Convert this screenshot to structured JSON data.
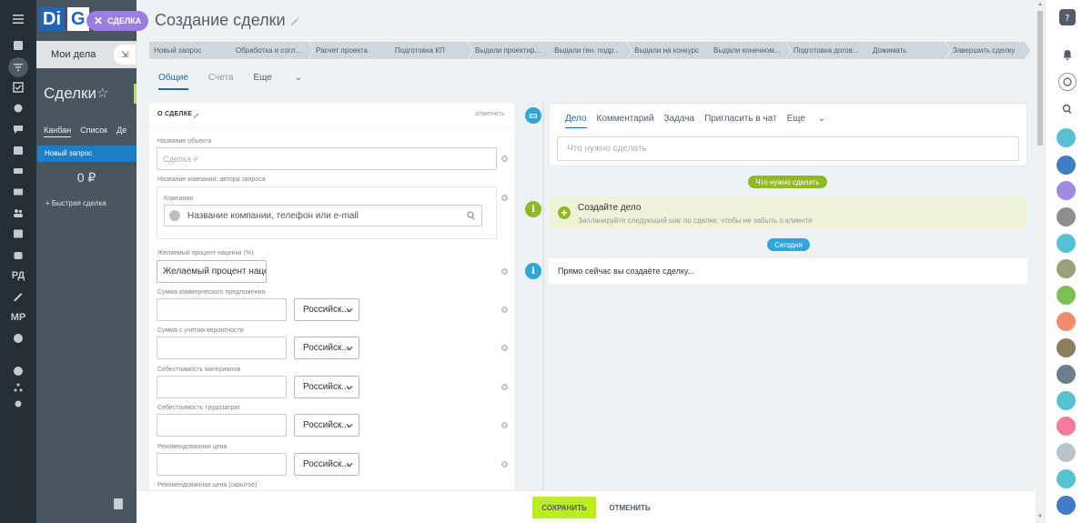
{
  "slider": {
    "title": "Создание сделки",
    "stages": [
      "Новый запрос",
      "Обработка и согл...",
      "Расчет проекта",
      "Подготовка КП",
      "Выдали проектир...",
      "Выдали ген. подр...",
      "Выдали на конкурс",
      "Выдали конечном...",
      "Подготовка догов...",
      "Дожимать",
      "Завершить сделку"
    ],
    "tabs": {
      "general": "Общие",
      "invoices": "Счета",
      "more": "Еще"
    },
    "section": {
      "title": "О СДЕЛКЕ",
      "cancel": "отменить"
    },
    "fields": {
      "object_label": "Название объекта",
      "object_placeholder": "Сделка #",
      "company_section_label": "Название компании, автора запроса",
      "company_label": "Компания",
      "company_placeholder": "Название компании, телефон или e-mail",
      "markup_label": "Желаемый процент наценки (%)",
      "markup_value": "Желаемый процент наце",
      "offer_label": "Сумма коммерческого предложения",
      "prob_label": "Сумма с учетом вероятности",
      "materials_label": "Себестоимость материалов",
      "labor_label": "Себестоимость трудозатрат",
      "recommended_label": "Рекомендованная цена",
      "recommended_hidden_label": "Рекомендованная цена (скрытое)",
      "currency": "Российск..."
    },
    "editor": {
      "tabs": [
        "Дело",
        "Комментарий",
        "Задача",
        "Пригласить в чат",
        "Еще"
      ],
      "placeholder": "Что нужно сделать"
    },
    "timeline": {
      "todo_badge": "Что нужно сделать",
      "plan_title": "Создайте дело",
      "plan_sub": "Запланируйте следующий шаг по сделке, чтобы не забыть о клиенте",
      "today_badge": "Сегодня",
      "now_text": "Прямо сейчас вы создаёте сделку..."
    },
    "footer": {
      "save": "СОХРАНИТЬ",
      "cancel": "ОТМЕНИТЬ"
    }
  },
  "background": {
    "logo_a": "Di",
    "logo_b": "G",
    "chip": "СДЕЛКА",
    "my_day": "Мои дела",
    "page_title": "Сделки",
    "tabs": [
      "Канбан",
      "Список",
      "Де"
    ],
    "stage": "Новый запрос",
    "sum": "0 ₽",
    "quick": "+ Быстрая сделка"
  },
  "left_nav": {
    "rd": "РД",
    "mr": "МР"
  },
  "colors": {
    "accent": "#2067b0",
    "save": "#bbed21",
    "green_badge": "#8fb927",
    "blue_badge": "#2fa5d9"
  }
}
